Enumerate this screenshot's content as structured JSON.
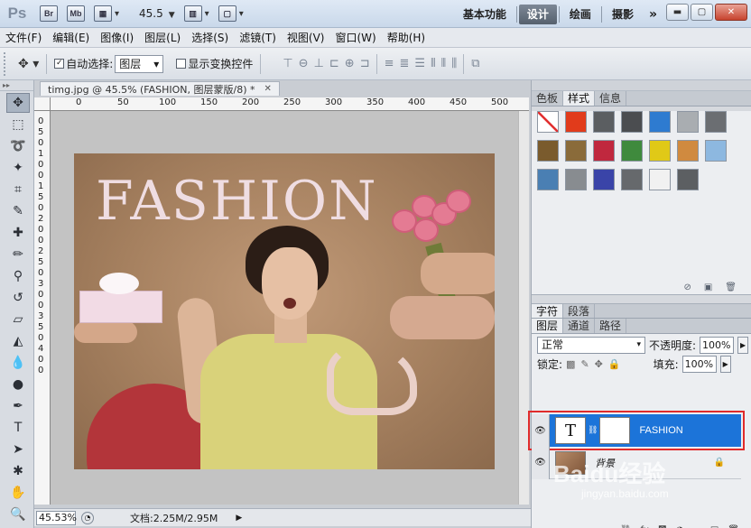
{
  "titlebar": {
    "app_logo": "Ps",
    "buttons": [
      "Br",
      "Mb"
    ],
    "zoom": "45.5",
    "workspaces": [
      "基本功能",
      "设计",
      "绘画",
      "摄影"
    ],
    "active_workspace": "设计",
    "more": "»"
  },
  "menu": [
    "文件(F)",
    "编辑(E)",
    "图像(I)",
    "图层(L)",
    "选择(S)",
    "滤镜(T)",
    "视图(V)",
    "窗口(W)",
    "帮助(H)"
  ],
  "options": {
    "auto_select_label": "自动选择:",
    "auto_select_value": "图层",
    "show_transform_label": "显示变换控件"
  },
  "document": {
    "tab_title": "timg.jpg @ 45.5% (FASHION, 图层蒙版/8) *",
    "ruler_h": [
      "0",
      "50",
      "100",
      "150",
      "200",
      "250",
      "300",
      "350",
      "400",
      "450",
      "500"
    ],
    "ruler_v": [
      "0",
      "5",
      "0",
      "1",
      "0",
      "0",
      "1",
      "5",
      "0",
      "2",
      "0",
      "0",
      "2",
      "5",
      "0",
      "3",
      "0",
      "0",
      "3",
      "5",
      "0",
      "4",
      "0",
      "0"
    ],
    "headline": "FASHION",
    "zoom_display": "45.53%",
    "doc_info": "文档:2.25M/2.95M"
  },
  "panels": {
    "top_tabs": [
      "色板",
      "样式",
      "信息"
    ],
    "active_top_tab": "样式",
    "char_tabs": [
      "字符",
      "段落"
    ],
    "layer_tabs": [
      "图层",
      "通道",
      "路径"
    ],
    "blend_mode": "正常",
    "opacity_label": "不透明度:",
    "opacity_value": "100%",
    "lock_label": "锁定:",
    "fill_label": "填充:",
    "fill_value": "100%",
    "layers": [
      {
        "name": "FASHION",
        "thumb": "T",
        "selected": true
      },
      {
        "name": "背景",
        "selected": false
      }
    ]
  },
  "watermark": {
    "main": "Baidu经验",
    "sub": "jingyan.baidu.com"
  },
  "colors": {
    "selected_layer": "#1c74d9",
    "highlight_box": "#e02b2b",
    "headline": "#efdde2",
    "active_workspace_bg": "#5f6a77"
  },
  "style_swatches": [
    "none",
    "#e13b1b",
    "#5b5e61",
    "#4b4d50",
    "#2e7bd0",
    "#a9adb1",
    "#6b6e72",
    "#7a5b2d",
    "#8a6b3a",
    "#c0283e",
    "#3f8a3d",
    "#e0c917",
    "#d08a3f",
    "#8db8e0",
    "#4a7fb3",
    "#888c90",
    "#3a44a8",
    "#66696c",
    "#f1f1f1",
    "#5c5f62"
  ]
}
